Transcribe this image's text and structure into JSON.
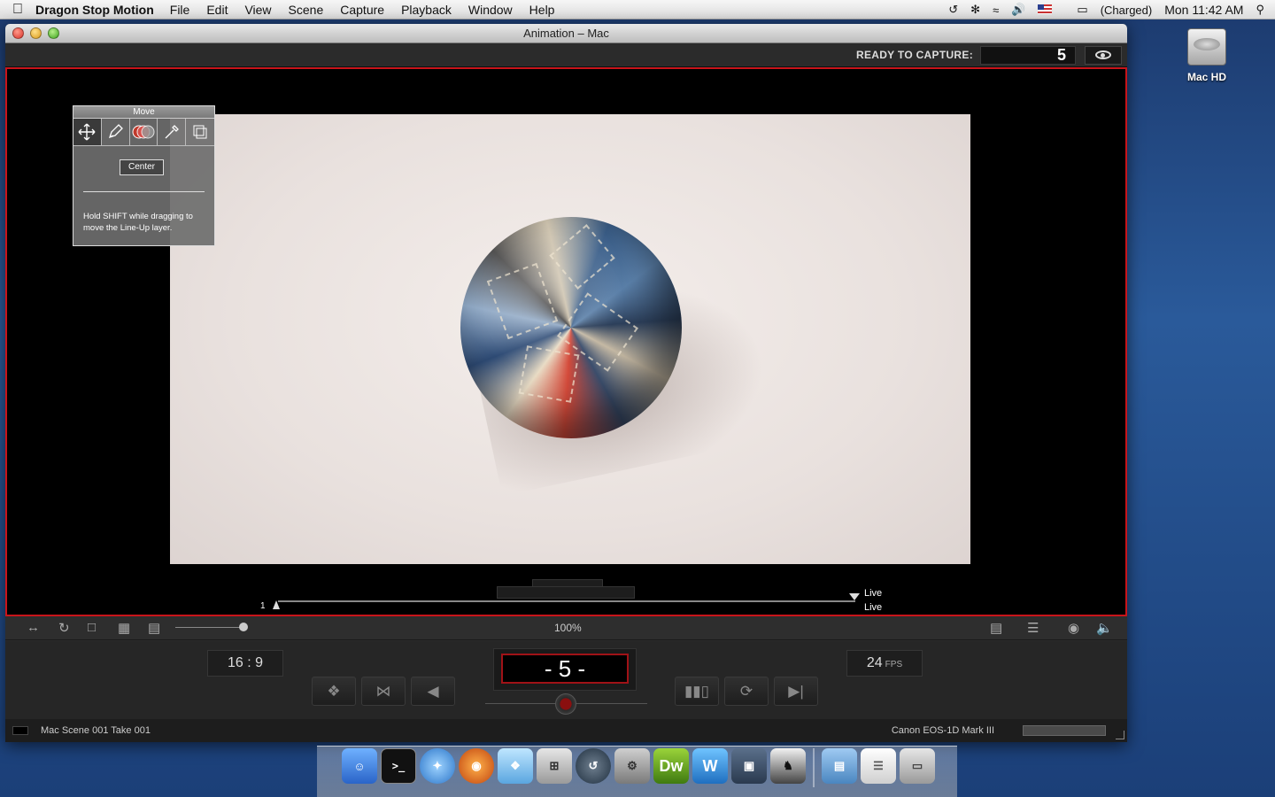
{
  "menubar": {
    "app_name": "Dragon Stop Motion",
    "items": [
      "File",
      "Edit",
      "View",
      "Scene",
      "Capture",
      "Playback",
      "Window",
      "Help"
    ],
    "battery": "(Charged)",
    "clock": "Mon 11:42 AM"
  },
  "window": {
    "title": "Animation – Mac",
    "ready_label": "READY TO CAPTURE:",
    "ready_count": "5"
  },
  "lineup_panel": {
    "title": "Move",
    "center_label": "Center",
    "hint": "Hold SHIFT while dragging to move the Line-Up layer."
  },
  "timeline": {
    "start": "1",
    "live_top": "Live",
    "live_bottom": "Live"
  },
  "toolbar": {
    "zoom": "100%"
  },
  "controls": {
    "aspect_ratio": "16 : 9",
    "frame": "- 5 -",
    "fps_value": "24",
    "fps_unit": "FPS"
  },
  "footer": {
    "scene_info": "Mac  Scene 001  Take 001",
    "camera": "Canon EOS-1D Mark III"
  },
  "desktop": {
    "hd_label": "Mac HD"
  },
  "colors": {
    "accent_red": "#c8141a",
    "frame_border": "#a01217"
  }
}
